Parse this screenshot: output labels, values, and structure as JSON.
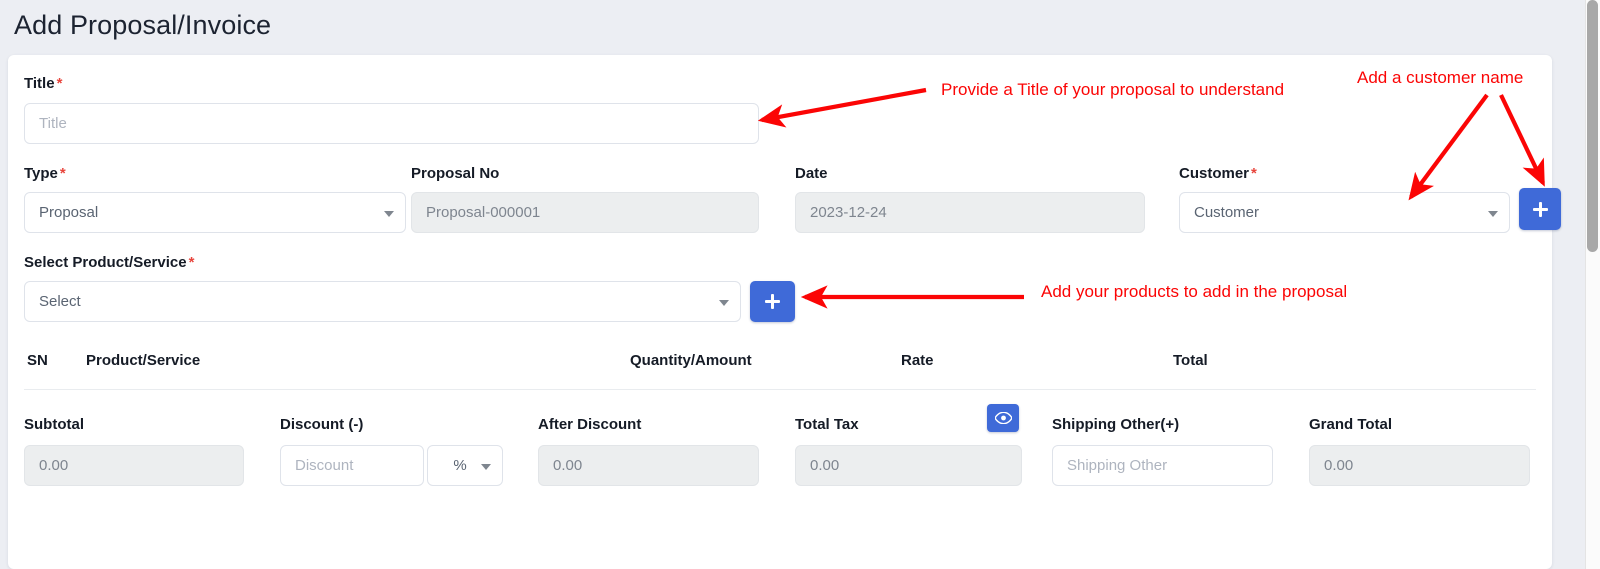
{
  "page": {
    "title": "Add Proposal/Invoice",
    "accent_color": "#3f6ad8",
    "annotation_color": "#fb0505",
    "background_color": "#eceef3"
  },
  "form": {
    "title_field": {
      "label": "Title",
      "required_mark": "*",
      "placeholder": "Title",
      "value": ""
    },
    "type_field": {
      "label": "Type",
      "required_mark": "*",
      "value": "Proposal"
    },
    "proposal_no_field": {
      "label": "Proposal No",
      "value": "Proposal-000001"
    },
    "date_field": {
      "label": "Date",
      "value": "2023-12-24"
    },
    "customer_field": {
      "label": "Customer",
      "required_mark": "*",
      "value": "Customer",
      "add_button_label": "+"
    },
    "product_field": {
      "label": "Select Product/Service",
      "required_mark": "*",
      "value": "Select",
      "add_button_label": "+"
    }
  },
  "items_table": {
    "columns": [
      "SN",
      "Product/Service",
      "Quantity/Amount",
      "Rate",
      "Total"
    ],
    "rows": []
  },
  "totals": {
    "subtotal": {
      "label": "Subtotal",
      "value": "0.00"
    },
    "discount": {
      "label": "Discount (-)",
      "placeholder": "Discount",
      "value": "",
      "unit": "%"
    },
    "after_discount": {
      "label": "After Discount",
      "value": "0.00"
    },
    "total_tax": {
      "label": "Total Tax",
      "value": "0.00",
      "eye_icon": "eye-icon"
    },
    "shipping_other": {
      "label": "Shipping Other(+)",
      "placeholder": "Shipping Other",
      "value": ""
    },
    "grand_total": {
      "label": "Grand Total",
      "value": "0.00"
    }
  },
  "annotations": [
    {
      "text": "Provide a Title of your proposal to understand"
    },
    {
      "text": "Add a customer name"
    },
    {
      "text": "Add your products to add in the proposal"
    }
  ]
}
